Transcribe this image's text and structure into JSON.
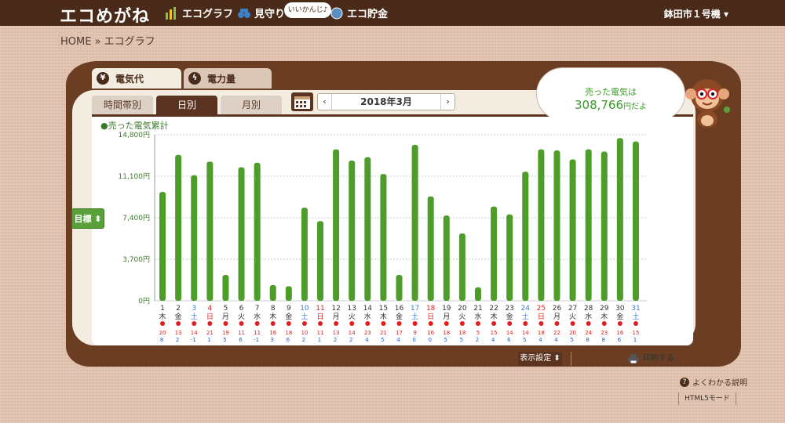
{
  "header": {
    "logo": "エコめがね",
    "nav": [
      {
        "label": "エコグラフ",
        "icon": "bar-chart-icon"
      },
      {
        "label": "見守り",
        "icon": "binoculars-icon"
      },
      {
        "label": "エコ貯金",
        "icon": "coin-icon"
      }
    ],
    "bubble": "いいかんじ♪",
    "account": "鉢田市１号機 ▾"
  },
  "breadcrumb": "HOME » エコグラフ",
  "tabs_top": [
    {
      "label": "電気代",
      "icon": "yen-icon"
    },
    {
      "label": "電力量",
      "icon": "lightning-icon"
    }
  ],
  "tabs_sub": [
    "時間帯別",
    "日別",
    "月別"
  ],
  "date_nav": {
    "prev": "‹",
    "label": "2018年3月",
    "next": "›"
  },
  "speech": {
    "line1": "売った電気は",
    "amount": "308,766",
    "suffix": "円だよ"
  },
  "legend": "●売った電気累計",
  "goal_button": "目標 ⬍",
  "controls": {
    "display_settings": "表示設定 ⬍",
    "print": "印刷する",
    "help": "よくわかる説明",
    "html5": "HTML5モード"
  },
  "colors": {
    "bar": "#4e9c2a",
    "sat": "#3a7ad8",
    "sun": "#e02020",
    "header": "#4a2b1a"
  },
  "chart_data": {
    "type": "bar",
    "ylim": [
      0,
      14800
    ],
    "yticks": [
      "0円",
      "3,700円",
      "7,400円",
      "11,100円",
      "14,800円"
    ],
    "ytick_values": [
      0,
      3700,
      7400,
      11100,
      14800
    ],
    "series": [
      {
        "name": "売った電気累計",
        "values": [
          9700,
          13000,
          11200,
          12400,
          2300,
          11900,
          12300,
          1400,
          1300,
          8300,
          7100,
          13500,
          12500,
          12800,
          11300,
          2300,
          13900,
          9300,
          7600,
          6000,
          1200,
          8400,
          7700,
          11500,
          13500,
          13400,
          12600,
          13500,
          13300,
          14500,
          14200
        ]
      }
    ],
    "days": [
      {
        "d": "1",
        "w": "木",
        "hi": "20",
        "lo": "8"
      },
      {
        "d": "2",
        "w": "金",
        "hi": "13",
        "lo": "2"
      },
      {
        "d": "3",
        "w": "土",
        "hi": "14",
        "lo": "-1"
      },
      {
        "d": "4",
        "w": "日",
        "hi": "21",
        "lo": "1"
      },
      {
        "d": "5",
        "w": "月",
        "hi": "19",
        "lo": "5"
      },
      {
        "d": "6",
        "w": "火",
        "hi": "11",
        "lo": "6"
      },
      {
        "d": "7",
        "w": "水",
        "hi": "11",
        "lo": "-1"
      },
      {
        "d": "8",
        "w": "木",
        "hi": "16",
        "lo": "3"
      },
      {
        "d": "9",
        "w": "金",
        "hi": "18",
        "lo": "6"
      },
      {
        "d": "10",
        "w": "土",
        "hi": "10",
        "lo": "2"
      },
      {
        "d": "11",
        "w": "日",
        "hi": "11",
        "lo": "1"
      },
      {
        "d": "12",
        "w": "月",
        "hi": "13",
        "lo": "2"
      },
      {
        "d": "13",
        "w": "火",
        "hi": "14",
        "lo": "2"
      },
      {
        "d": "14",
        "w": "水",
        "hi": "23",
        "lo": "4"
      },
      {
        "d": "15",
        "w": "木",
        "hi": "21",
        "lo": "5"
      },
      {
        "d": "16",
        "w": "金",
        "hi": "17",
        "lo": "4"
      },
      {
        "d": "17",
        "w": "土",
        "hi": "9",
        "lo": "0"
      },
      {
        "d": "18",
        "w": "日",
        "hi": "16",
        "lo": "0"
      },
      {
        "d": "19",
        "w": "月",
        "hi": "18",
        "lo": "5"
      },
      {
        "d": "20",
        "w": "火",
        "hi": "18",
        "lo": "5"
      },
      {
        "d": "21",
        "w": "水",
        "hi": "5",
        "lo": "2"
      },
      {
        "d": "22",
        "w": "木",
        "hi": "15",
        "lo": "4"
      },
      {
        "d": "23",
        "w": "金",
        "hi": "14",
        "lo": "6"
      },
      {
        "d": "24",
        "w": "土",
        "hi": "14",
        "lo": "5"
      },
      {
        "d": "25",
        "w": "日",
        "hi": "18",
        "lo": "4"
      },
      {
        "d": "26",
        "w": "月",
        "hi": "22",
        "lo": "4"
      },
      {
        "d": "27",
        "w": "火",
        "hi": "20",
        "lo": "5"
      },
      {
        "d": "28",
        "w": "水",
        "hi": "24",
        "lo": "8"
      },
      {
        "d": "29",
        "w": "木",
        "hi": "23",
        "lo": "8"
      },
      {
        "d": "30",
        "w": "金",
        "hi": "16",
        "lo": "6"
      },
      {
        "d": "31",
        "w": "土",
        "hi": "15",
        "lo": "1"
      }
    ]
  }
}
